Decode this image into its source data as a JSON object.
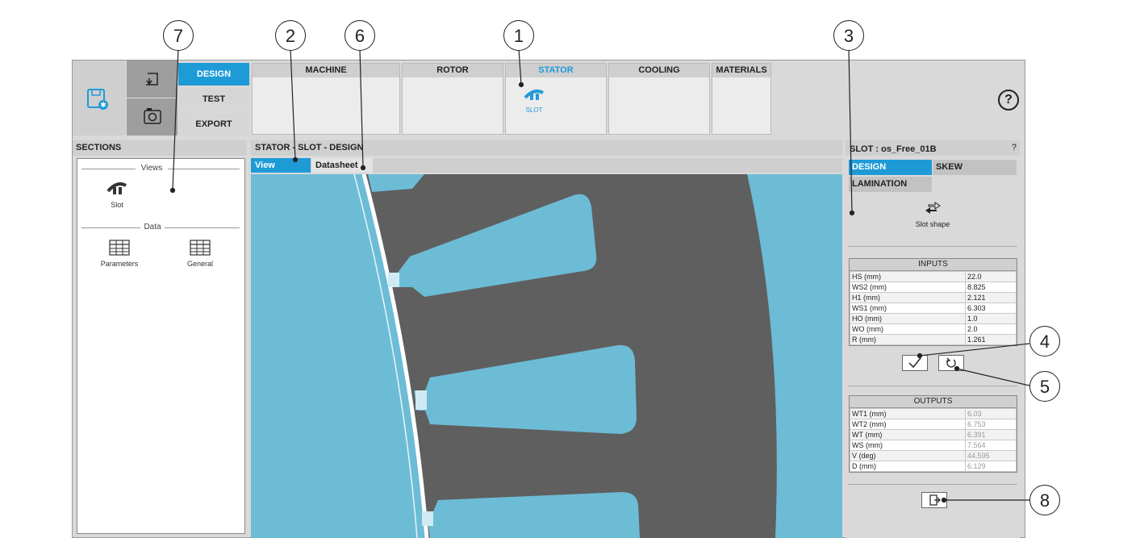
{
  "toolbar": {
    "menu": [
      "DESIGN",
      "TEST",
      "EXPORT"
    ],
    "tabs": [
      "MACHINE",
      "ROTOR",
      "STATOR",
      "COOLING",
      "MATERIALS"
    ],
    "stator_item": "SLOT",
    "help": "?"
  },
  "sections": {
    "title": "SECTIONS",
    "views_label": "Views",
    "slot_label": "Slot",
    "data_label": "Data",
    "parameters_label": "Parameters",
    "general_label": "General"
  },
  "center": {
    "title": "STATOR - SLOT - DESIGN",
    "tabs": [
      "View",
      "Datasheet"
    ]
  },
  "right": {
    "title": "SLOT : os_Free_01B",
    "help": "?",
    "tabs": [
      "DESIGN",
      "SKEW",
      "LAMINATION"
    ],
    "slot_shape_label": "Slot shape",
    "inputs_title": "INPUTS",
    "inputs": [
      {
        "name": "HS (mm)",
        "value": "22.0"
      },
      {
        "name": "WS2 (mm)",
        "value": "8.825"
      },
      {
        "name": "H1 (mm)",
        "value": "2.121"
      },
      {
        "name": "WS1 (mm)",
        "value": "6.303"
      },
      {
        "name": "HO (mm)",
        "value": "1.0"
      },
      {
        "name": "WO (mm)",
        "value": "2.0"
      },
      {
        "name": "R (mm)",
        "value": "1.261"
      }
    ],
    "outputs_title": "OUTPUTS",
    "outputs": [
      {
        "name": "WT1 (mm)",
        "value": "6.03"
      },
      {
        "name": "WT2 (mm)",
        "value": "6.753"
      },
      {
        "name": "WT (mm)",
        "value": "6.391"
      },
      {
        "name": "WS (mm)",
        "value": "7.564"
      },
      {
        "name": "V (deg)",
        "value": "44.595"
      },
      {
        "name": "D (mm)",
        "value": "6.129"
      }
    ]
  },
  "callouts": [
    "1",
    "2",
    "3",
    "4",
    "5",
    "6",
    "7",
    "8"
  ],
  "colors": {
    "accent": "#1e9bd7",
    "slot_blue": "#6dbcd6",
    "steel": "#5f5f5f"
  }
}
